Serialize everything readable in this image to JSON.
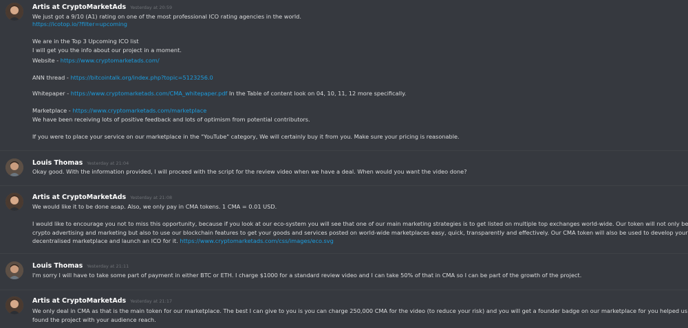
{
  "messages": [
    {
      "author": "Artis at CryptoMarketAds",
      "time": "Yesterday at 20:59",
      "lines": [
        {
          "text": "We just got a 9/10 (A1) rating on one of the most professional ICO rating agencies in the world."
        },
        {
          "link": "https://icotop.io/?filter=upcoming"
        },
        {
          "text": "We are in the Top 3 Upcoming ICO list"
        },
        {
          "text": "I will get you the info about our project in a moment."
        },
        {
          "text": "Website - ",
          "link": "https://www.cryptomarketads.com/"
        },
        {
          "text": "ANN thread - ",
          "link": "https://bitcointalk.org/index.php?topic=5123256.0"
        },
        {
          "text": "Whitepaper - ",
          "link": "https://www.cryptomarketads.com/CMA_whitepaper.pdf",
          "after": " In the Table of content look on 04, 10, 11, 12 more specifically."
        },
        {
          "text": "Marketplace - ",
          "link": "https://www.cryptomarketads.com/marketplace"
        },
        {
          "text": "We have been receiving lots of positive feedback and lots of optimism from potential  contributors."
        },
        {
          "text": "If you were to place your service on our marketplace in the \"YouTube\" category, We will certainly buy it from you. Make sure your pricing is reasonable."
        }
      ]
    },
    {
      "author": "Louis Thomas",
      "time": "Yesterday at 21:04",
      "lines": [
        {
          "text": "Okay good. With the information provided, I will proceed with the script for the review video when we have a deal. When would you want the video done?"
        }
      ]
    },
    {
      "author": "Artis at CryptoMarketAds",
      "time": "Yesterday at 21:08",
      "lines": [
        {
          "text": "We would like it to be done asap. Also, we only pay in CMA tokens. 1 CMA = 0.01 USD."
        },
        {
          "text": "I would like to encourage you not to miss this opportunity, because if you look at our eco-system you will see that one of our main marketing strategies is to get listed on multiple top exchanges world-wide. Our token will not only be used for"
        },
        {
          "text": "crypto advertising and marketing but also to use our blockchain features to get your goods and services posted on world-wide marketplaces easy, quick, transparently and effectively. Our CMA token will also be used to develop your own"
        },
        {
          "text": "decentralised marketplace and launch an ICO for it.  ",
          "link": "https://www.cryptomarketads.com/css/images/eco.svg"
        }
      ]
    },
    {
      "author": "Louis Thomas",
      "time": "Yesterday at 21:11",
      "lines": [
        {
          "text": "I'm sorry I will have to take some part of payment in either BTC or ETH. I charge $1000 for a standard review video and I can take 50% of that in CMA so I can be part of the growth of the project."
        }
      ]
    },
    {
      "author": "Artis at CryptoMarketAds",
      "time": "Yesterday at 21:17",
      "lines": [
        {
          "text": "We only deal in CMA as that is the main token for our marketplace. The best I can give to you is you can charge 250,000 CMA for the video (to reduce your risk)  and you will get a founder badge on our marketplace for you helped us"
        },
        {
          "text": "found the project with your audience reach."
        }
      ]
    }
  ]
}
